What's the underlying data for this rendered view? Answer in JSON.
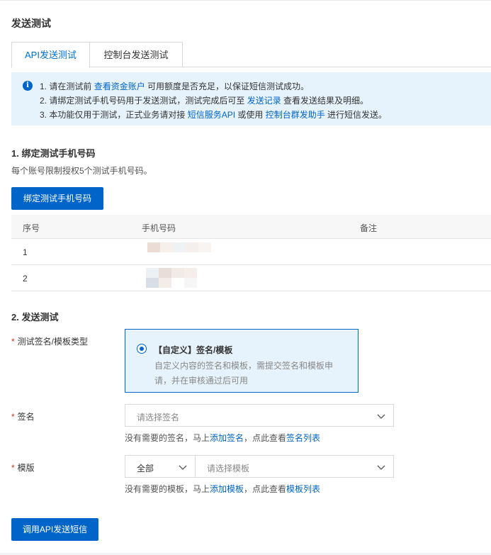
{
  "page": {
    "title": "发送测试"
  },
  "tabs": [
    {
      "label": "API发送测试",
      "active": true
    },
    {
      "label": "控制台发送测试",
      "active": false
    }
  ],
  "notice": {
    "line1": {
      "pre": "1. 请在测试前 ",
      "link": "查看资金账户",
      "post": " 可用额度是否充足，以保证短信测试成功。"
    },
    "line2": {
      "pre": "2. 请绑定测试手机号码用于发送测试，测试完成后可至 ",
      "link": "发送记录",
      "post": " 查看发送结果及明细。"
    },
    "line3": {
      "pre": "3. 本功能仅用于测试，正式业务请对接 ",
      "link1": "短信服务API",
      "mid": " 或使用 ",
      "link2": "控制台群发助手",
      "post": " 进行短信发送。"
    }
  },
  "section1": {
    "title": "1. 绑定测试手机号码",
    "description": "每个账号限制授权5个测试手机号码。",
    "bind_button": "绑定测试手机号码",
    "table": {
      "headers": [
        "序号",
        "手机号码",
        "备注"
      ],
      "rows": [
        {
          "index": "1"
        },
        {
          "index": "2"
        }
      ]
    }
  },
  "section2": {
    "title": "2. 发送测试",
    "type_label": "测试签名/模板类型",
    "card": {
      "title": "【自定义】签名/模板",
      "description": "自定义内容的签名和模板，需提交签名和模板申请，并在审核通过后可用"
    },
    "signature": {
      "label": "签名",
      "placeholder": "请选择签名",
      "hint_pre": "没有需要的签名，马上",
      "hint_link1": "添加签名",
      "hint_mid": "，点此查看",
      "hint_link2": "签名列表"
    },
    "template": {
      "label": "模版",
      "filter_value": "全部",
      "placeholder": "请选择模板",
      "hint_pre": "没有需要的模板，马上",
      "hint_link1": "添加模板",
      "hint_mid": "，点此查看",
      "hint_link2": "模板列表"
    },
    "submit_button": "调用API发送短信"
  },
  "colors": {
    "primary": "#0064c8",
    "notice_bg": "#e6f3fc",
    "required": "#d93026"
  }
}
